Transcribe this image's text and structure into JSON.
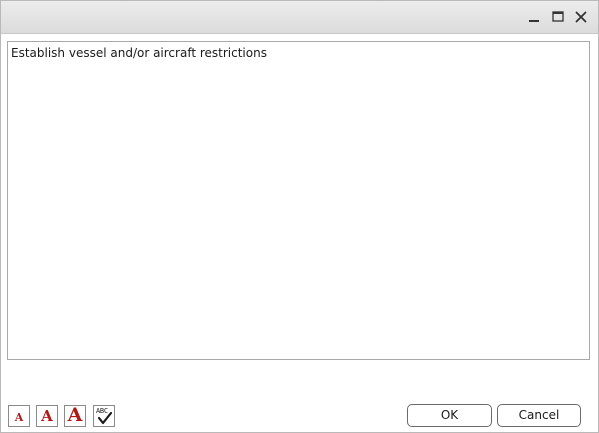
{
  "window": {
    "controls": {
      "minimize_icon": "minimize-icon",
      "maximize_icon": "maximize-icon",
      "close_icon": "close-icon"
    }
  },
  "editor": {
    "text": "Establish vessel and/or aircraft restrictions"
  },
  "toolbar": {
    "tools": [
      {
        "name": "font-size-small",
        "glyph": "A"
      },
      {
        "name": "font-size-medium",
        "glyph": "A"
      },
      {
        "name": "font-size-large",
        "glyph": "A"
      },
      {
        "name": "spell-check",
        "glyph": "ABC"
      }
    ],
    "glyph_color": "#b01818"
  },
  "buttons": {
    "ok_label": "OK",
    "cancel_label": "Cancel"
  }
}
